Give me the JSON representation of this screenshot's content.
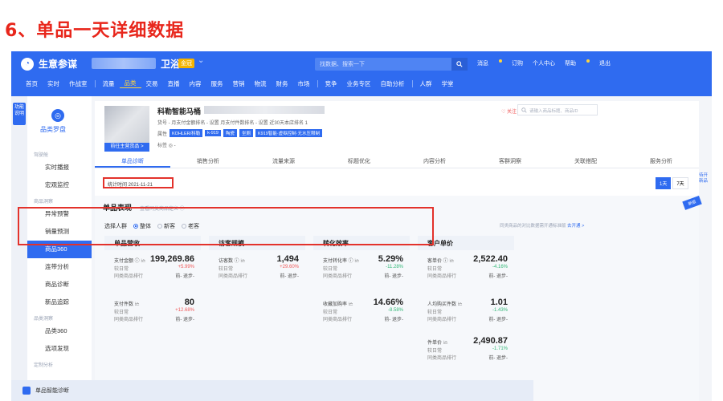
{
  "heading": "6、单品一天详细数据",
  "app": {
    "name": "生意参谋",
    "store_name": "卫浴",
    "store_badge": "金冠"
  },
  "topbar": {
    "search_placeholder": "找数据、搜索一下",
    "links": [
      "消息",
      "订购",
      "个人中心",
      "帮助",
      "退出"
    ]
  },
  "main_nav": [
    "首页",
    "实时",
    "作战室",
    "流量",
    "品类",
    "交易",
    "直播",
    "内容",
    "服务",
    "营销",
    "物流",
    "财务",
    "市场",
    "竞争",
    "业务专区",
    "自助分析",
    "人群",
    "学堂"
  ],
  "left_strip": "功能说明",
  "sidebar": {
    "title": "品类罗盘",
    "groups": [
      {
        "label": "驾驶舱",
        "items": [
          "实时播报",
          "宏观监控"
        ]
      },
      {
        "label": "商品洞察",
        "items": [
          "异常预警",
          "销量预测",
          "商品360",
          "连带分析",
          "商品诊断",
          "新品追踪"
        ]
      },
      {
        "label": "品类洞察",
        "items": [
          "品类360",
          "选项发现"
        ]
      },
      {
        "label": "定制分析",
        "items": []
      }
    ],
    "active_item": "商品360"
  },
  "product": {
    "title_prefix": "科勒智能马桶",
    "meta": "货号 -      月支付金额排名 - 设置      月支付件数排名 - 设置      近30天本店排名 1",
    "attr_label": "属性",
    "chips": [
      "KOHLER/科勒",
      "k-919",
      "陶瓷",
      "坐厕",
      "K919智能·虚拟控制·无水压限制"
    ],
    "tag_line": "标签 ◎   -",
    "go_button": "前往主营货品 >",
    "follow": "♡ 关注",
    "search_placeholder": "请输入商品标题、商品ID"
  },
  "subtabs": [
    "单品诊断",
    "销售分析",
    "流量来源",
    "标题优化",
    "内容分析",
    "客群洞察",
    "关联搭配",
    "服务分析"
  ],
  "stat_time": "统计时间 2021-11-21",
  "range": [
    "1天",
    "7天"
  ],
  "panel": {
    "corner": "新版",
    "title": "单品表现",
    "subtitle": "查看同类商品定义 ⓘ",
    "crowd_label": "选择人群",
    "crowd_options": [
      "整体",
      "新客",
      "老客"
    ],
    "hint": "同类商品的对比数据需开通标准版",
    "hint_link": "去开通 >"
  },
  "columns": [
    {
      "title": "单品营收",
      "cards": [
        {
          "label": "支付金额 ⓘ 🗠",
          "value": "199,269.86",
          "sub1": "较日常",
          "change": "+5.99%",
          "dir": "up",
          "sub2": "同类商品排行",
          "rank": "前- 退步-"
        },
        {
          "label": "支付件数 🗠",
          "value": "80",
          "sub1": "较日常",
          "change": "+12.68%",
          "dir": "up",
          "sub2": "同类商品排行",
          "rank": "前- 退步-"
        }
      ]
    },
    {
      "title": "访客规模",
      "cards": [
        {
          "label": "访客数 ⓘ 🗠",
          "value": "1,494",
          "sub1": "较日常",
          "change": "+29.60%",
          "dir": "up",
          "sub2": "同类商品排行",
          "rank": "前- 退步-"
        }
      ]
    },
    {
      "title": "转化效率",
      "cards": [
        {
          "label": "支付转化率 ⓘ 🗠",
          "value": "5.29%",
          "sub1": "较日常",
          "change": "-11.28%",
          "dir": "down",
          "sub2": "同类商品排行",
          "rank": "前- 退步-"
        },
        {
          "label": "收藏加购率 🗠",
          "value": "14.66%",
          "sub1": "较日常",
          "change": "-8.58%",
          "dir": "down",
          "sub2": "同类商品排行",
          "rank": "前- 退步-"
        }
      ]
    },
    {
      "title": "客户单价",
      "cards": [
        {
          "label": "客单价 ⓘ 🗠",
          "value": "2,522.40",
          "sub1": "较日常",
          "change": "-4.16%",
          "dir": "down",
          "sub2": "同类商品排行",
          "rank": "前- 退步-"
        },
        {
          "label": "人均购买件数 🗠",
          "value": "1.01",
          "sub1": "较日常",
          "change": "-1.43%",
          "dir": "down",
          "sub2": "同类商品排行",
          "rank": "前- 退步-"
        },
        {
          "label": "件单价 🗠",
          "value": "2,490.87",
          "sub1": "较日常",
          "change": "-1.71%",
          "dir": "down",
          "sub2": "同类商品排行",
          "rank": "前- 退步-"
        }
      ]
    }
  ],
  "bottom_card": "单品智能诊断",
  "right_edge": "待开新品",
  "colors": {
    "brand": "#2f6bf0",
    "highlight": "#e3322b",
    "heading": "#e8261b",
    "up": "#f05a5a",
    "down": "#33b877"
  }
}
